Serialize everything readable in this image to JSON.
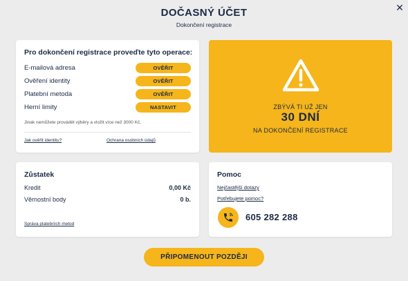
{
  "header": {
    "title": "DOČASNÝ ÚČET",
    "subtitle": "Dokončení registrace",
    "close_icon": "close-icon"
  },
  "steps": {
    "heading": "Pro dokončení registrace proveďte tyto operace:",
    "items": [
      {
        "label": "E-mailová adresa",
        "button": "OVĚŘIT"
      },
      {
        "label": "Ověření identity",
        "button": "OVĚŘIT"
      },
      {
        "label": "Platební metoda",
        "button": "OVĚŘIT"
      },
      {
        "label": "Herní limity",
        "button": "NASTAVIT"
      }
    ],
    "note": "Jinak nemůžete provádět výběry a vložit více než 3000 Kč.",
    "links": {
      "verify_identity": "Jak ověřit identitu?",
      "privacy": "Ochrana osobních údajů"
    }
  },
  "warning": {
    "icon": "warning-icon",
    "line1": "ZBÝVÁ TI UŽ JEN",
    "days": "30 DNÍ",
    "line3": "NA DOKONČENÍ REGISTRACE"
  },
  "balance": {
    "heading": "Zůstatek",
    "rows": [
      {
        "label": "Kredit",
        "value": "0,00 Kč"
      },
      {
        "label": "Věrnostní body",
        "value": "0 b."
      }
    ],
    "link": "Správa platebních metod"
  },
  "help": {
    "heading": "Pomoc",
    "faq": "Nejčastější dotazy",
    "need_help": "Potřebujete pomoc?",
    "phone_icon": "phone-icon",
    "phone": "605 282 288"
  },
  "remind_button": "PŘIPOMENOUT POZDĚJI",
  "colors": {
    "accent": "#f5b51b",
    "text": "#1b2a44",
    "background": "#ececec"
  }
}
